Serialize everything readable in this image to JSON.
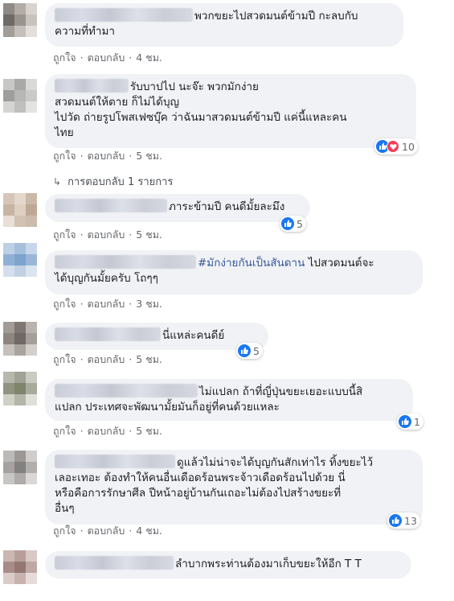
{
  "actions": {
    "like": "ถูกใจ",
    "reply": "ตอบกลับ",
    "sep": "·"
  },
  "comments": [
    {
      "text": "พวกขยะไปสวดมนต์ข้ามปี กะลบกับ",
      "text2": "ความที่ทำมา",
      "time": "4 ชม."
    },
    {
      "line1": "รับบาปไป นะจ๊ะ พวกมักง่าย",
      "line2": "สวดมนต์ให้ตาย ก็ไม่ได้บุญ",
      "line3": "ไปวัด ถ่ายรูปโพสเฟซบุ๊ค ว่าฉันมาสวดมนต์ข้ามปี แค่นี้แหละคน",
      "line4": "ไทย",
      "time": "5 ชม.",
      "reactions": "10"
    },
    {
      "text": "ภาระข้ามปี คนดีมั้ยละมึง",
      "time": "5 ชม.",
      "reactions": "5"
    },
    {
      "hashtag": "#มักง่ายกันเป็นสันดาน",
      "text": " ไปสวดมนต์จะ",
      "text2": "ได้บุญกันมั้ยครับ โถๆๆ",
      "time": "3 ชม."
    },
    {
      "text": "นี่แหล่ะคนดีย์",
      "time": "5 ชม.",
      "reactions": "5"
    },
    {
      "text": "ไม่แปลก ถ้าที่ญี่ปุ่นขยะเยอะแบบนี้สิ",
      "text2": "แปลก ประเทศจะพัฒนามั้ยมันก็อยู่ที่คนด้วยแหละ",
      "time": "5 ชม.",
      "reactions": "1"
    },
    {
      "text": "ดูแล้วไม่น่าจะได้บุญกันสักเท่าไร ทิ้งขยะไว้",
      "line2": "เลอะเทอะ ต้องทำให้คนอื่นเดือดร้อนพระจ้าวเดือดร้อนไปด้วย นี่",
      "line3": "หรือคือการรักษาศีล ปีหน้าอยู่บ้านกันเถอะไม่ต้องไปสร้างขยะที่",
      "line4": "อื่นๆ",
      "time": "4 ชม.",
      "reactions": "13"
    },
    {
      "text": "ลำบากพระท่านต้องมาเก็บขยะให้อีก T T"
    }
  ],
  "replies_link": "การตอบกลับ 1 รายการ",
  "colors": {
    "like": "#1877f2",
    "love": "#f33e58",
    "bubble": "#f0f2f5",
    "meta": "#65676b",
    "hashtag": "#385898"
  }
}
